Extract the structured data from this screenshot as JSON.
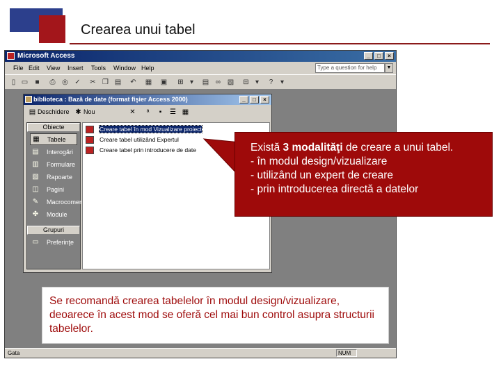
{
  "slide": {
    "title": "Crearea unui tabel"
  },
  "access_window": {
    "title": "Microsoft Access",
    "menu": [
      "File",
      "Edit",
      "View",
      "Insert",
      "Tools",
      "Window",
      "Help"
    ],
    "help_placeholder": "Type a question for help",
    "status_left": "Gata",
    "status_num": "NUM"
  },
  "db_window": {
    "title": "biblioteca : Bază de date (format fişier Access 2000)",
    "toolbar": {
      "design_label": "Deschidere",
      "new_label": "Nou"
    },
    "objects_header": "Obiecte",
    "objects": [
      {
        "label": "Tabele",
        "icon": "table-icon"
      },
      {
        "label": "Interogări",
        "icon": "query-icon"
      },
      {
        "label": "Formulare",
        "icon": "form-icon"
      },
      {
        "label": "Rapoarte",
        "icon": "report-icon"
      },
      {
        "label": "Pagini",
        "icon": "page-icon"
      },
      {
        "label": "Macrocomenzi",
        "icon": "macro-icon"
      },
      {
        "label": "Module",
        "icon": "module-icon"
      }
    ],
    "groups_header": "Grupuri",
    "groups": [
      {
        "label": "Preferinţe",
        "icon": "favorites-icon"
      }
    ],
    "list_items": [
      "Creare tabel în mod Vizualizare proiect",
      "Creare tabel utilizând Expertul",
      "Creare tabel prin introducere de date"
    ]
  },
  "callout_main": {
    "line1_prefix": "Există ",
    "line1_bold": "3 modalităţi",
    "line1_suffix": " de creare a unui tabel.",
    "items": [
      "- în modul design/vizualizare",
      "- utilizând un expert de creare",
      "- prin introducerea directă a datelor"
    ]
  },
  "callout_bottom": {
    "text": "Se recomandă crearea tabelelor în modul design/vizualizare, deoarece în acest mod se oferă cel mai bun control asupra structurii tabelelor."
  },
  "colors": {
    "accent_red": "#9e0a0a",
    "accent_blue": "#2c3f8c",
    "title_bar": "#0a246a"
  }
}
